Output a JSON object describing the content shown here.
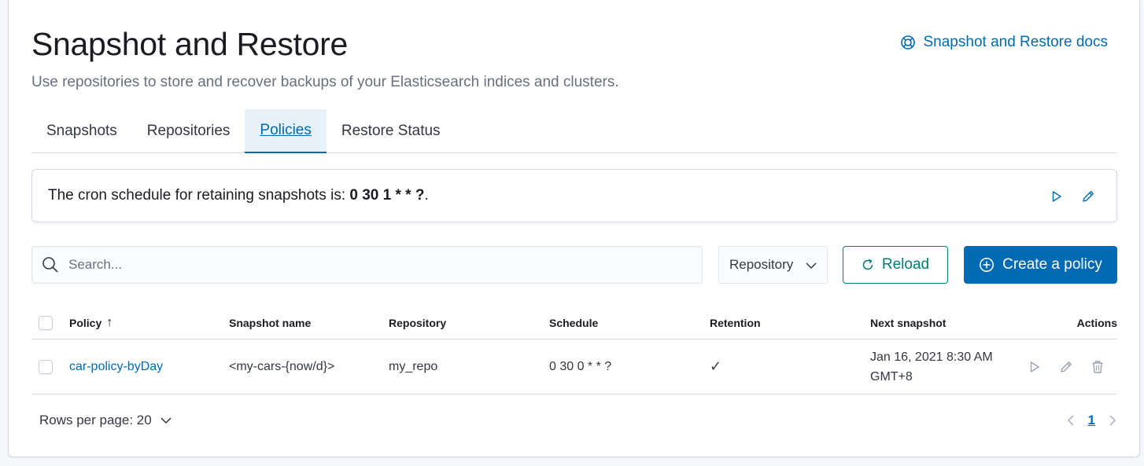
{
  "page": {
    "title": "Snapshot and Restore",
    "subtitle": "Use repositories to store and recover backups of your Elasticsearch indices and clusters.",
    "docs_link": "Snapshot and Restore docs"
  },
  "tabs": [
    {
      "label": "Snapshots",
      "active": false
    },
    {
      "label": "Repositories",
      "active": false
    },
    {
      "label": "Policies",
      "active": true
    },
    {
      "label": "Restore Status",
      "active": false
    }
  ],
  "callout": {
    "text_prefix": "The cron schedule for retaining snapshots is: ",
    "cron": "0 30 1 * * ?",
    "text_suffix": "."
  },
  "toolbar": {
    "search_placeholder": "Search...",
    "repository_filter": "Repository",
    "reload_label": "Reload",
    "create_label": "Create a policy"
  },
  "table": {
    "columns": [
      "Policy",
      "Snapshot name",
      "Repository",
      "Schedule",
      "Retention",
      "Next snapshot",
      "Actions"
    ],
    "sort_indicator": "↑",
    "rows": [
      {
        "policy": "car-policy-byDay",
        "snapshot_name": "<my-cars-{now/d}>",
        "repository": "my_repo",
        "schedule": "0 30 0 * * ?",
        "retention": "✓",
        "next_snapshot_line1": "Jan 16, 2021 8:30 AM",
        "next_snapshot_line2": "GMT+8"
      }
    ]
  },
  "pagination": {
    "rows_per_page_label": "Rows per page: 20",
    "current_page": "1"
  },
  "colors": {
    "accent": "#006bb4",
    "reload": "#017d73",
    "active_tab_bg": "#e6f1fa"
  }
}
